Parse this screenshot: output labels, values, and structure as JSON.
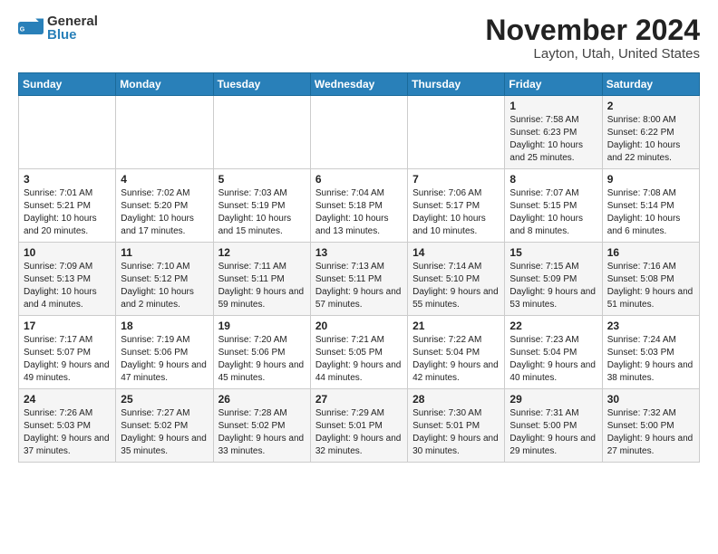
{
  "logo": {
    "general": "General",
    "blue": "Blue"
  },
  "title": {
    "month": "November 2024",
    "location": "Layton, Utah, United States"
  },
  "weekdays": [
    "Sunday",
    "Monday",
    "Tuesday",
    "Wednesday",
    "Thursday",
    "Friday",
    "Saturday"
  ],
  "weeks": [
    [
      {
        "day": "",
        "info": ""
      },
      {
        "day": "",
        "info": ""
      },
      {
        "day": "",
        "info": ""
      },
      {
        "day": "",
        "info": ""
      },
      {
        "day": "",
        "info": ""
      },
      {
        "day": "1",
        "info": "Sunrise: 7:58 AM\nSunset: 6:23 PM\nDaylight: 10 hours and 25 minutes."
      },
      {
        "day": "2",
        "info": "Sunrise: 8:00 AM\nSunset: 6:22 PM\nDaylight: 10 hours and 22 minutes."
      }
    ],
    [
      {
        "day": "3",
        "info": "Sunrise: 7:01 AM\nSunset: 5:21 PM\nDaylight: 10 hours and 20 minutes."
      },
      {
        "day": "4",
        "info": "Sunrise: 7:02 AM\nSunset: 5:20 PM\nDaylight: 10 hours and 17 minutes."
      },
      {
        "day": "5",
        "info": "Sunrise: 7:03 AM\nSunset: 5:19 PM\nDaylight: 10 hours and 15 minutes."
      },
      {
        "day": "6",
        "info": "Sunrise: 7:04 AM\nSunset: 5:18 PM\nDaylight: 10 hours and 13 minutes."
      },
      {
        "day": "7",
        "info": "Sunrise: 7:06 AM\nSunset: 5:17 PM\nDaylight: 10 hours and 10 minutes."
      },
      {
        "day": "8",
        "info": "Sunrise: 7:07 AM\nSunset: 5:15 PM\nDaylight: 10 hours and 8 minutes."
      },
      {
        "day": "9",
        "info": "Sunrise: 7:08 AM\nSunset: 5:14 PM\nDaylight: 10 hours and 6 minutes."
      }
    ],
    [
      {
        "day": "10",
        "info": "Sunrise: 7:09 AM\nSunset: 5:13 PM\nDaylight: 10 hours and 4 minutes."
      },
      {
        "day": "11",
        "info": "Sunrise: 7:10 AM\nSunset: 5:12 PM\nDaylight: 10 hours and 2 minutes."
      },
      {
        "day": "12",
        "info": "Sunrise: 7:11 AM\nSunset: 5:11 PM\nDaylight: 9 hours and 59 minutes."
      },
      {
        "day": "13",
        "info": "Sunrise: 7:13 AM\nSunset: 5:11 PM\nDaylight: 9 hours and 57 minutes."
      },
      {
        "day": "14",
        "info": "Sunrise: 7:14 AM\nSunset: 5:10 PM\nDaylight: 9 hours and 55 minutes."
      },
      {
        "day": "15",
        "info": "Sunrise: 7:15 AM\nSunset: 5:09 PM\nDaylight: 9 hours and 53 minutes."
      },
      {
        "day": "16",
        "info": "Sunrise: 7:16 AM\nSunset: 5:08 PM\nDaylight: 9 hours and 51 minutes."
      }
    ],
    [
      {
        "day": "17",
        "info": "Sunrise: 7:17 AM\nSunset: 5:07 PM\nDaylight: 9 hours and 49 minutes."
      },
      {
        "day": "18",
        "info": "Sunrise: 7:19 AM\nSunset: 5:06 PM\nDaylight: 9 hours and 47 minutes."
      },
      {
        "day": "19",
        "info": "Sunrise: 7:20 AM\nSunset: 5:06 PM\nDaylight: 9 hours and 45 minutes."
      },
      {
        "day": "20",
        "info": "Sunrise: 7:21 AM\nSunset: 5:05 PM\nDaylight: 9 hours and 44 minutes."
      },
      {
        "day": "21",
        "info": "Sunrise: 7:22 AM\nSunset: 5:04 PM\nDaylight: 9 hours and 42 minutes."
      },
      {
        "day": "22",
        "info": "Sunrise: 7:23 AM\nSunset: 5:04 PM\nDaylight: 9 hours and 40 minutes."
      },
      {
        "day": "23",
        "info": "Sunrise: 7:24 AM\nSunset: 5:03 PM\nDaylight: 9 hours and 38 minutes."
      }
    ],
    [
      {
        "day": "24",
        "info": "Sunrise: 7:26 AM\nSunset: 5:03 PM\nDaylight: 9 hours and 37 minutes."
      },
      {
        "day": "25",
        "info": "Sunrise: 7:27 AM\nSunset: 5:02 PM\nDaylight: 9 hours and 35 minutes."
      },
      {
        "day": "26",
        "info": "Sunrise: 7:28 AM\nSunset: 5:02 PM\nDaylight: 9 hours and 33 minutes."
      },
      {
        "day": "27",
        "info": "Sunrise: 7:29 AM\nSunset: 5:01 PM\nDaylight: 9 hours and 32 minutes."
      },
      {
        "day": "28",
        "info": "Sunrise: 7:30 AM\nSunset: 5:01 PM\nDaylight: 9 hours and 30 minutes."
      },
      {
        "day": "29",
        "info": "Sunrise: 7:31 AM\nSunset: 5:00 PM\nDaylight: 9 hours and 29 minutes."
      },
      {
        "day": "30",
        "info": "Sunrise: 7:32 AM\nSunset: 5:00 PM\nDaylight: 9 hours and 27 minutes."
      }
    ]
  ]
}
